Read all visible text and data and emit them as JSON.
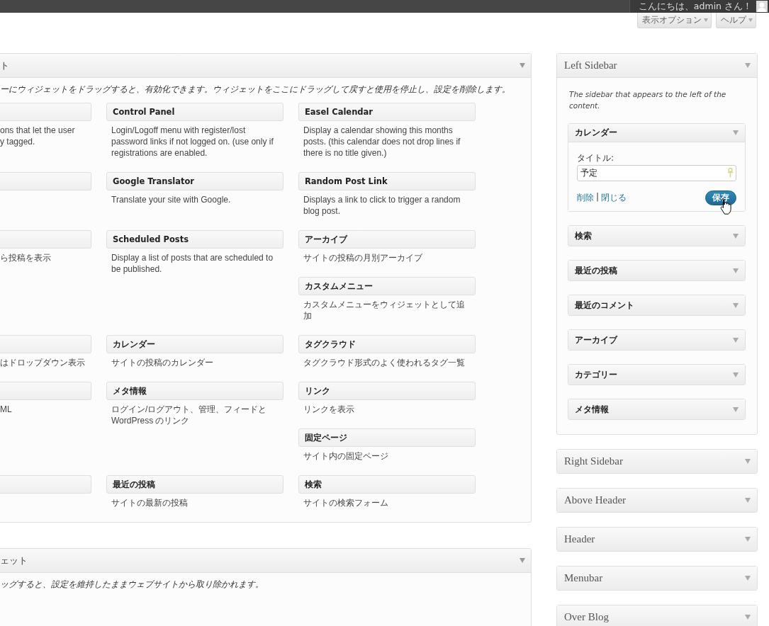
{
  "admin_bar": {
    "greeting": "こんにちは、admin さん！"
  },
  "screen_buttons": [
    {
      "label": "表示オプション"
    },
    {
      "label": "ヘルプ"
    }
  ],
  "available_widgets": {
    "title": "ト",
    "description": "ーにウィジェットをドラッグすると、有効化できます。ウィジェットをここにドラッグして戻すと使用を停止し、設定を削除します。",
    "rows": [
      [
        [
          {
            "description": "ons that let the user\ny tagged."
          }
        ],
        [
          {
            "title": "Control Panel",
            "description": "Login/Logoff menu with register/lost password links if not logged on. (use only if registrations are enabled."
          }
        ],
        [
          {
            "title": "Easel Calendar",
            "description": "Display a calendar showing this months posts. (this calendar does not drop lines if there is no title given.)"
          }
        ]
      ],
      [
        [
          {}
        ],
        [
          {
            "title": "Google Translator",
            "description": "Translate your site with Google."
          }
        ],
        [
          {
            "title": "Random Post Link",
            "description": "Displays a link to click to trigger a random blog post."
          }
        ]
      ],
      [
        [
          {
            "description": "ら投稿を表示"
          }
        ],
        [
          {
            "title": "Scheduled Posts",
            "description": "Display a list of posts that are scheduled to be published."
          }
        ],
        [
          {
            "title": "アーカイブ",
            "description": "サイトの投稿の月別アーカイブ"
          },
          {
            "title": "カスタムメニュー",
            "description": "カスタムメニューをウィジェットとして追加"
          }
        ]
      ],
      [
        [
          {
            "description": "はドロップダウン表示"
          }
        ],
        [
          {
            "title": "カレンダー",
            "description": "サイトの投稿のカレンダー"
          }
        ],
        [
          {
            "title": "タグクラウド",
            "description": "タグクラウド形式のよく使われるタグ一覧"
          }
        ]
      ],
      [
        [
          {
            "description": "ML"
          }
        ],
        [
          {
            "title": "メタ情報",
            "description": "ログイン/ログアウト、管理、フィードと WordPress のリンク"
          }
        ],
        [
          {
            "title": "リンク",
            "description": "リンクを表示"
          },
          {
            "title": "固定ページ",
            "description": "サイト内の固定ページ"
          }
        ]
      ],
      [
        [
          {}
        ],
        [
          {
            "title": "最近の投稿",
            "description": "サイトの最新の投稿"
          }
        ],
        [
          {
            "title": "検索",
            "description": "サイトの検索フォーム"
          }
        ]
      ]
    ]
  },
  "inactive_widgets": {
    "title": "ェット",
    "description": "ッグすると、設定を維持したままウェブサイトから取り除かれます。"
  },
  "sidebars": [
    {
      "name": "Left Sidebar",
      "expanded": true,
      "description": "The sidebar that appears to the left of the content.",
      "widgets": [
        {
          "title": "カレンダー",
          "expanded": true,
          "field_label": "タイトル:",
          "field_value": "予定",
          "delete_link": "削除",
          "separator": "|",
          "close_link": "閉じる",
          "save_button": "保存"
        },
        {
          "title": "検索",
          "expanded": false
        },
        {
          "title": "最近の投稿",
          "expanded": false
        },
        {
          "title": "最近のコメント",
          "expanded": false
        },
        {
          "title": "アーカイブ",
          "expanded": false
        },
        {
          "title": "カテゴリー",
          "expanded": false
        },
        {
          "title": "メタ情報",
          "expanded": false
        }
      ]
    },
    {
      "name": "Right Sidebar",
      "expanded": false
    },
    {
      "name": "Above Header",
      "expanded": false
    },
    {
      "name": "Header",
      "expanded": false
    },
    {
      "name": "Menubar",
      "expanded": false
    },
    {
      "name": "Over Blog",
      "expanded": false
    }
  ]
}
